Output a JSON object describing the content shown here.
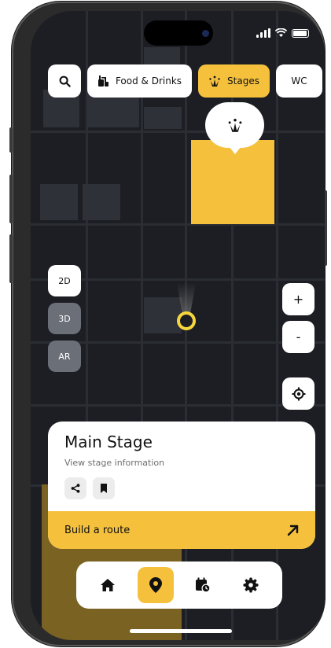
{
  "status_bar": {
    "signal_icon": "cellular-signal-icon",
    "wifi_icon": "wifi-icon",
    "battery_icon": "battery-icon"
  },
  "toolbar": {
    "search_icon": "search-icon",
    "filters": [
      {
        "label": "Food & Drinks",
        "icon": "food-drinks-icon",
        "active": false
      },
      {
        "label": "Stages",
        "icon": "stage-icon",
        "active": true
      },
      {
        "label": "WC",
        "icon": "",
        "active": false
      }
    ]
  },
  "map": {
    "selected_marker_icon": "stage-icon"
  },
  "view_modes": [
    {
      "label": "2D",
      "active": true
    },
    {
      "label": "3D",
      "active": false
    },
    {
      "label": "AR",
      "active": false
    }
  ],
  "zoom": {
    "in_label": "+",
    "out_label": "-"
  },
  "locate_icon": "locate-me-icon",
  "card": {
    "title": "Main Stage",
    "subtitle": "View stage information",
    "share_icon": "share-icon",
    "bookmark_icon": "bookmark-icon",
    "route_label": "Build a route",
    "route_icon": "arrow-up-right-icon"
  },
  "nav": [
    {
      "name": "home",
      "icon": "home-icon",
      "active": false
    },
    {
      "name": "map",
      "icon": "map-pin-icon",
      "active": true
    },
    {
      "name": "schedule",
      "icon": "calendar-clock-icon",
      "active": false
    },
    {
      "name": "settings",
      "icon": "gear-icon",
      "active": false
    }
  ],
  "colors": {
    "accent": "#f5c13d",
    "map_bg": "#1c1e23",
    "inactive_view": "#6b6f78"
  }
}
